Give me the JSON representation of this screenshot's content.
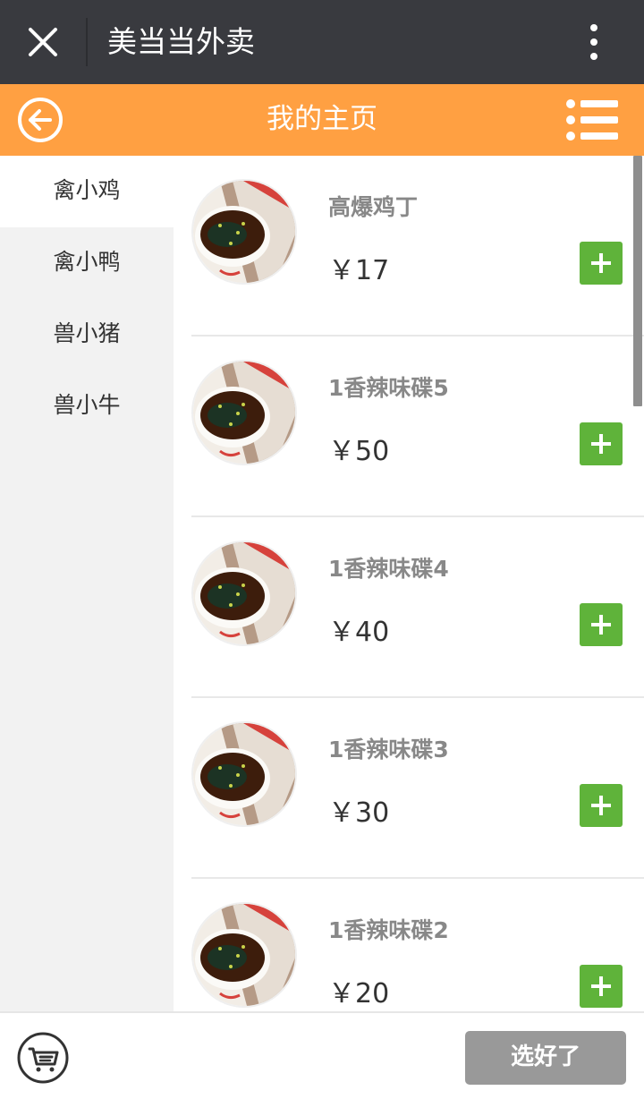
{
  "wechat_bar": {
    "title": "美当当外卖",
    "close_icon": "close-icon",
    "more_icon": "more-vertical-icon"
  },
  "header": {
    "title": "我的主页",
    "back_icon": "back-arrow-icon",
    "menu_icon": "list-menu-icon",
    "color": "#ffa042"
  },
  "sidebar": {
    "items": [
      {
        "label": "禽小鸡",
        "active": true
      },
      {
        "label": "禽小鸭",
        "active": false
      },
      {
        "label": "兽小猪",
        "active": false
      },
      {
        "label": "兽小牛",
        "active": false
      }
    ]
  },
  "products": [
    {
      "name": "高爆鸡丁",
      "price": "￥17",
      "image_icon": "food-bowl-image"
    },
    {
      "name": "1香辣味碟5",
      "price": "￥50",
      "image_icon": "food-bowl-image"
    },
    {
      "name": "1香辣味碟4",
      "price": "￥40",
      "image_icon": "food-bowl-image"
    },
    {
      "name": "1香辣味碟3",
      "price": "￥30",
      "image_icon": "food-bowl-image"
    },
    {
      "name": "1香辣味碟2",
      "price": "￥20",
      "image_icon": "food-bowl-image"
    }
  ],
  "add_button_color": "#5fb33a",
  "footer": {
    "cart_icon": "cart-icon",
    "done_label": "选好了"
  }
}
